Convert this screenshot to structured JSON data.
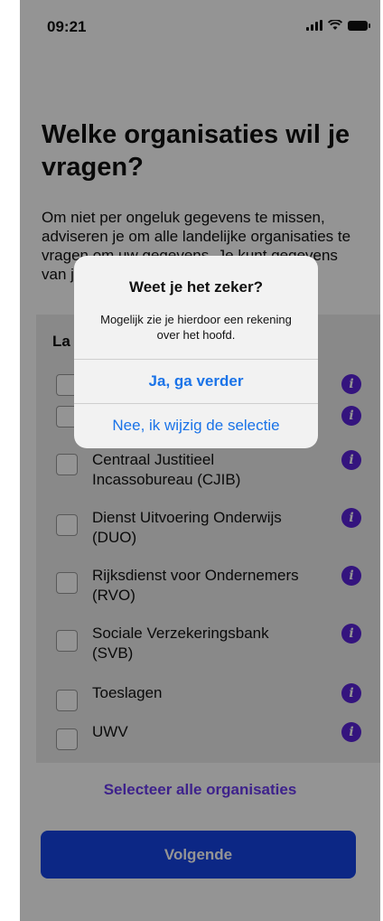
{
  "status_bar": {
    "time": "09:21"
  },
  "page": {
    "title": "Welke organisaties wil je vragen?",
    "intro": "Om niet per ongeluk gegevens te missen, adviseren je om alle landelijke organisaties te vragen om uw gegevens. Je kunt gegevens van je ...",
    "section_heading": "La",
    "organizations": [
      {
        "label": ""
      },
      {
        "label": ""
      },
      {
        "label": "Centraal Justitieel Incassobureau (CJIB)"
      },
      {
        "label": "Dienst Uitvoering Onderwijs (DUO)"
      },
      {
        "label": "Rijksdienst voor Ondernemers (RVO)"
      },
      {
        "label": "Sociale Verzekeringsbank (SVB)"
      },
      {
        "label": "Toeslagen"
      },
      {
        "label": "UWV"
      }
    ],
    "select_all": "Selecteer alle organisaties",
    "next_button": "Volgende"
  },
  "dialog": {
    "title": "Weet je het zeker?",
    "message": "Mogelijk zie je hierdoor een rekening over het hoofd.",
    "confirm": "Ja, ga verder",
    "cancel": "Nee, ik wijzig de selectie"
  },
  "colors": {
    "accent_purple": "#6b3cf0",
    "primary_blue": "#1544e6",
    "link_blue": "#1a73e8"
  }
}
